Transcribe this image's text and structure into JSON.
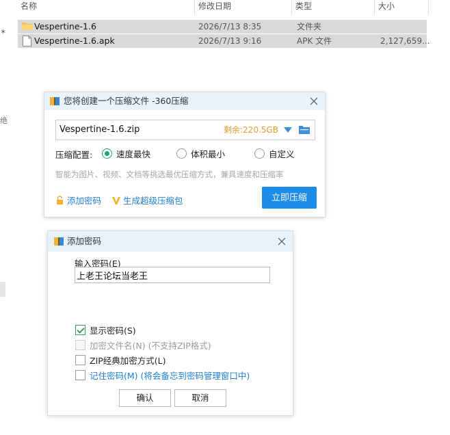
{
  "explorer": {
    "columns": {
      "name": "名称",
      "date": "修改日期",
      "type": "类型",
      "size": "大小"
    },
    "files": [
      {
        "name": "Vespertine-1.6",
        "date": "2026/7/13 8:35",
        "type": "文件夹",
        "size": "",
        "icon": "folder-icon"
      },
      {
        "name": "Vespertine-1.6.apk",
        "date": "2026/7/13 9:16",
        "type": "APK 文件",
        "size": "2,127,659...",
        "icon": "file-icon"
      }
    ],
    "edge_chars": [
      "绝"
    ]
  },
  "compress_dialog": {
    "title": "您将创建一个压缩文件 -360压缩",
    "filename": "Vespertine-1.6.zip",
    "free_space": "剩余:220.5GB",
    "config_label": "压缩配置:",
    "options": [
      "速度最快",
      "体积最小",
      "自定义"
    ],
    "selected_option": "速度最快",
    "hint": "智能为图片、视频、文档等挑选最优压缩方式，兼具速度和压缩率",
    "add_password_link": "添加密码",
    "super_package_link": "生成超级压缩包",
    "compress_button": "立即压缩"
  },
  "password_dialog": {
    "title": "添加密码",
    "input_label": "输入密码(E)",
    "password_value": "上老王论坛当老王",
    "checkboxes": [
      {
        "label": "显示密码(S)",
        "checked": true,
        "enabled": true
      },
      {
        "label": "加密文件名(N)",
        "extra": "(不支持ZIP格式)",
        "checked": false,
        "enabled": false
      },
      {
        "label": "ZIP经典加密方式(L)",
        "checked": false,
        "enabled": true
      },
      {
        "label": "记住密码(M)",
        "extra": "(将会备忘到密码管理窗口中)",
        "checked": false,
        "enabled": true
      }
    ],
    "ok_button": "确认",
    "cancel_button": "取消"
  },
  "colors": {
    "accent_blue": "#1d8be8",
    "link_blue": "#1f7ed0",
    "free_space_orange": "#e59a2f",
    "radio_green": "#1ea36b",
    "selected_row": "#d9d9d9",
    "title_bar": "#e8f2fb"
  }
}
